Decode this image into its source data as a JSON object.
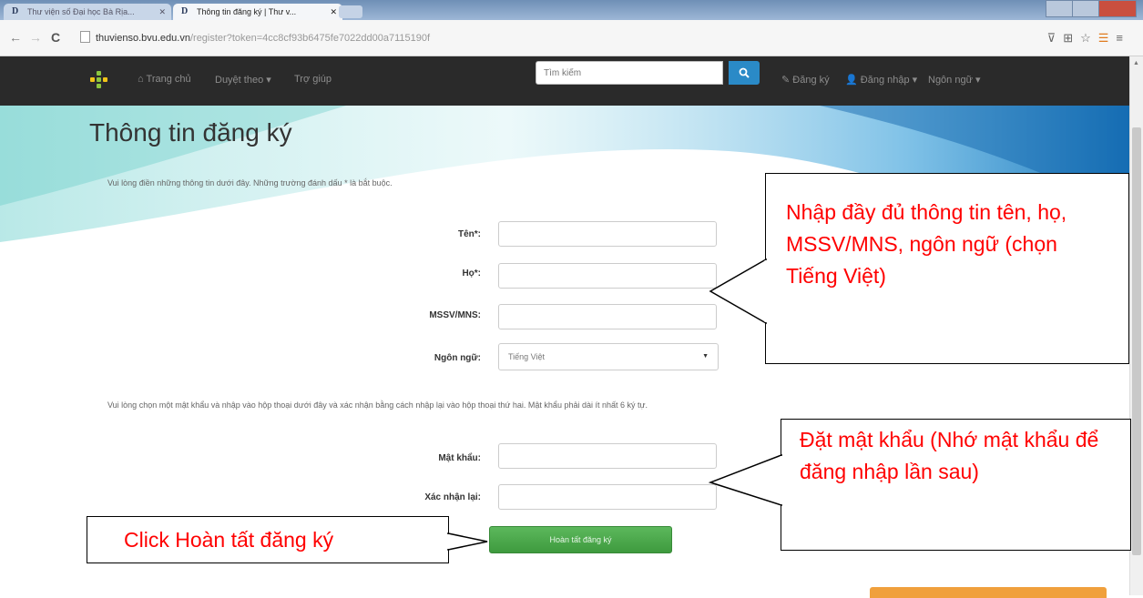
{
  "browser": {
    "tabs": [
      {
        "label": "Thư viện số Đại học Bà Rịa..."
      },
      {
        "label": "Thông tin đăng ký | Thư v..."
      }
    ],
    "url_host": "thuvienso.bvu.edu.vn",
    "url_path": "/register?token=4cc8cf93b6475fe7022dd00a7115190f",
    "accent": "#e07a1e"
  },
  "nav": {
    "home": "Trang chủ",
    "browse": "Duyệt theo ▾",
    "help": "Trợ giúp",
    "search_placeholder": "Tìm kiếm",
    "register": "Đăng ký",
    "login": "Đăng nhập ▾",
    "language": "Ngôn ngữ ▾"
  },
  "page": {
    "title": "Thông tin đăng ký",
    "intro": "Vui lòng điền những thông tin dưới đây. Những trường đánh dấu * là bắt buộc.",
    "fields": {
      "first_name": "Tên*:",
      "last_name": "Họ*:",
      "student_id": "MSSV/MNS:",
      "language": "Ngôn ngữ:",
      "language_value": "Tiếng Việt",
      "password": "Mật khẩu:",
      "confirm": "Xác nhận lại:"
    },
    "password_note": "Vui lòng chọn một mật khẩu và nhập vào hộp thoại dưới đây và xác nhận bằng cách nhập lại vào hộp thoại thứ hai. Mật khẩu phải dài ít nhất 6 ký tự.",
    "submit": "Hoàn tất đăng ký",
    "submit_color": "#4cae4c"
  },
  "callouts": {
    "fill_info": "Nhập đầy đủ thông tin tên, họ, MSSV/MNS, ngôn ngữ (chọn Tiếng Việt)",
    "set_password": "Đặt mật khẩu (Nhớ mật khẩu để đăng nhập lần sau)",
    "click_submit": "Click Hoàn tất đăng ký",
    "color": "#ff0000"
  }
}
